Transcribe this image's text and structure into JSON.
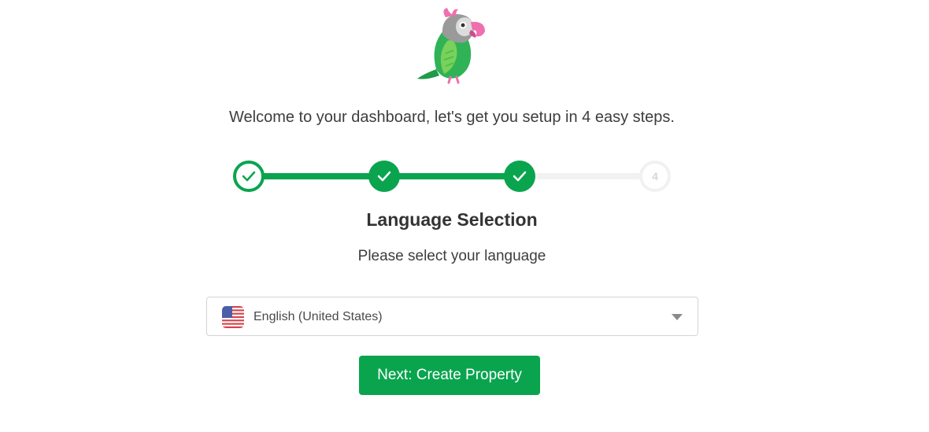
{
  "welcome_text": "Welcome to your dashboard, let's get you setup in 4 easy steps.",
  "stepper": {
    "steps": [
      {
        "state": "completed",
        "icon": "check-icon"
      },
      {
        "state": "completed",
        "icon": "check-icon"
      },
      {
        "state": "completed",
        "icon": "check-icon"
      },
      {
        "state": "pending",
        "label": "4"
      }
    ],
    "accent_color": "#0aa44f",
    "inactive_color": "#f1f1f1"
  },
  "section": {
    "title": "Language Selection",
    "subtitle": "Please select your language"
  },
  "language_select": {
    "selected_value": "English (United States)",
    "flag_icon": "us-flag-icon",
    "chevron_icon": "chevron-down-icon"
  },
  "next_button_label": "Next: Create Property",
  "logo_icon": "parrot-logo-icon"
}
